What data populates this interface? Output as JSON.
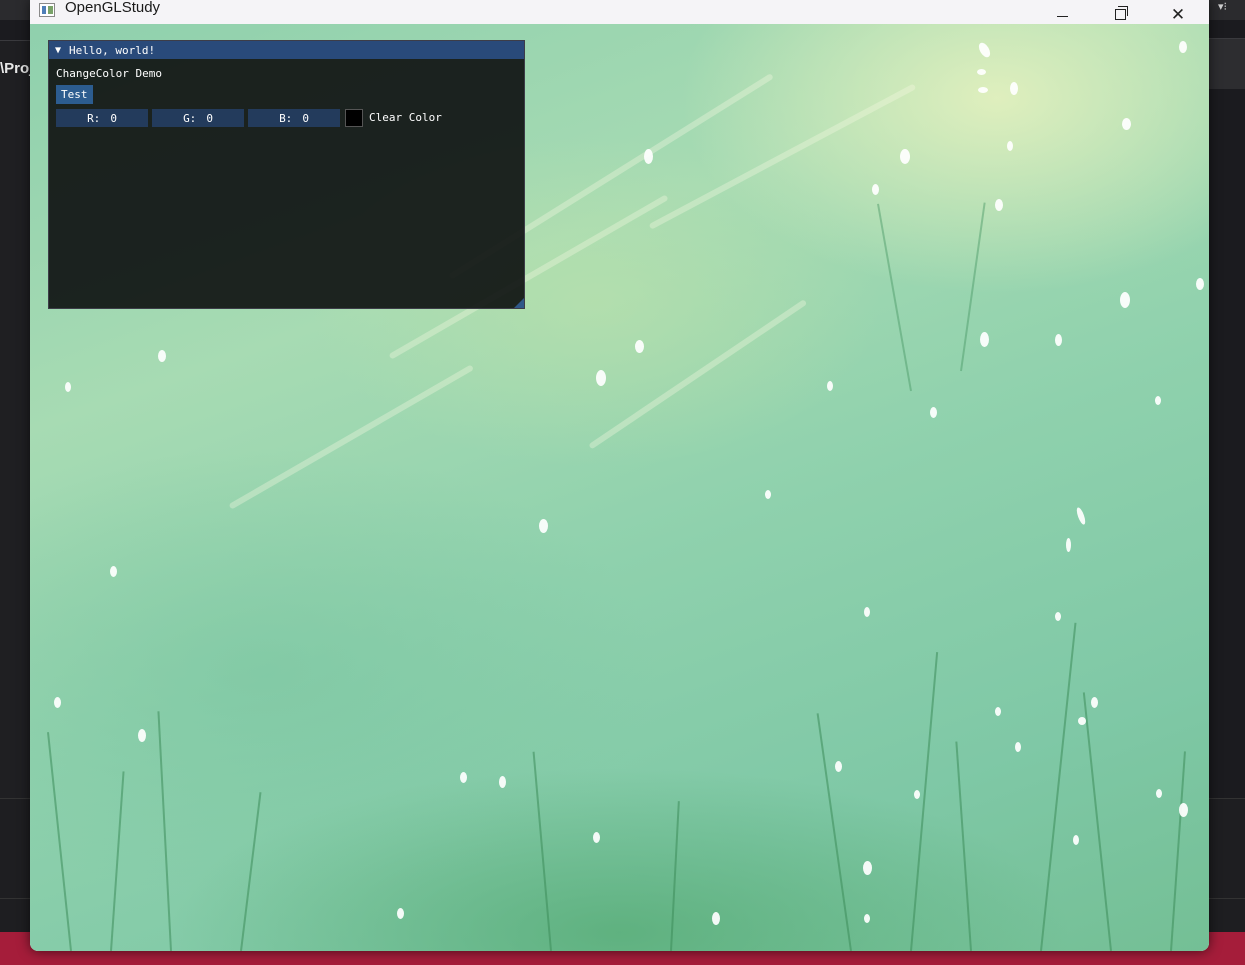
{
  "background_ide": {
    "project_label": "\\Proj"
  },
  "window": {
    "title": "OpenGLStudy",
    "icon": "app-icon",
    "controls": [
      "minimize-icon",
      "maximize-icon",
      "close-icon"
    ]
  },
  "imgui": {
    "title": "Hello, world!",
    "collapse_icon": "▼",
    "label": "ChangeColor Demo",
    "button": "Test",
    "sliders": [
      {
        "label": "R:",
        "value": "0"
      },
      {
        "label": "G:",
        "value": "0"
      },
      {
        "label": "B:",
        "value": "0"
      }
    ],
    "color_label": "Clear Color",
    "swatch_color": "#000000"
  },
  "colors": {
    "title_bar_active": "#294a7a",
    "button": "#2c5c8f",
    "frame_bg": "#233b5c",
    "ide_status_bar": "#a51d3a"
  }
}
